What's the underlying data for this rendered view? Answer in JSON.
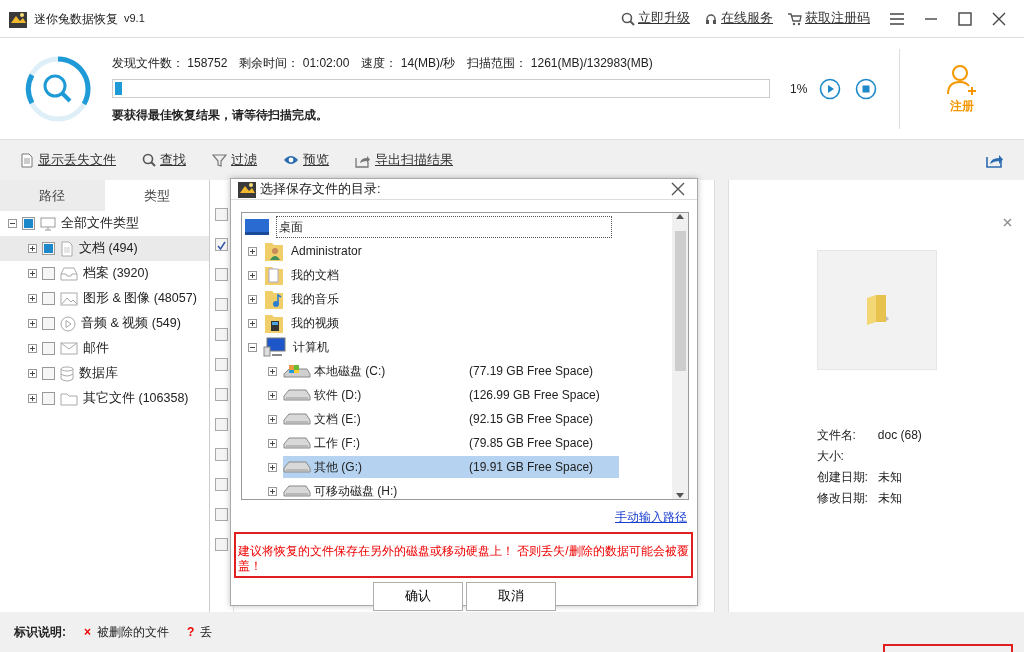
{
  "window": {
    "title": "迷你兔数据恢复",
    "version": "v9.1",
    "actions": [
      {
        "kind": "search",
        "label": "立即升级"
      },
      {
        "kind": "support",
        "label": "在线服务"
      },
      {
        "kind": "cart",
        "label": "获取注册码"
      }
    ]
  },
  "scan": {
    "stats": [
      {
        "label": "发现文件数：",
        "value": "158752"
      },
      {
        "label": "剩余时间：",
        "value": "01:02:00"
      },
      {
        "label": "速度：",
        "value": "14(MB)/秒"
      },
      {
        "label": "扫描范围：",
        "value": "1261(MB)/132983(MB)"
      }
    ],
    "level": 0.01,
    "percent": "1%",
    "message": "要获得最佳恢复结果，请等待扫描完成。",
    "register": "注册"
  },
  "toolbar": [
    {
      "kind": "doc",
      "label": "显示丢失文件"
    },
    {
      "kind": "search",
      "label": "查找"
    },
    {
      "kind": "filter",
      "label": "过滤"
    },
    {
      "kind": "eye",
      "label": "预览"
    },
    {
      "kind": "export",
      "label": "导出扫描结果"
    }
  ],
  "tabs": [
    {
      "label": "路径",
      "selected": false
    },
    {
      "label": "类型",
      "selected": true
    }
  ],
  "type_tree": {
    "label": "全部文件类型",
    "partial": true,
    "selected": false,
    "children": [
      {
        "kind": "document",
        "label": "文档 (494)",
        "partial": true,
        "selected": true
      },
      {
        "kind": "archive",
        "label": "档案 (3920)",
        "partial": false,
        "selected": false
      },
      {
        "kind": "image",
        "label": "图形 & 图像 (48057)",
        "partial": false,
        "selected": false
      },
      {
        "kind": "media",
        "label": "音频 & 视频 (549)",
        "partial": false,
        "selected": false
      },
      {
        "kind": "mail",
        "label": "邮件",
        "partial": false,
        "selected": false
      },
      {
        "kind": "database",
        "label": "数据库",
        "partial": false,
        "selected": false
      },
      {
        "kind": "folder",
        "label": "其它文件 (106358)",
        "partial": false,
        "selected": false
      }
    ]
  },
  "file_rows": [
    {
      "checked": false
    },
    {
      "checked": true
    },
    {
      "checked": false
    },
    {
      "checked": false
    },
    {
      "checked": false
    },
    {
      "checked": false
    },
    {
      "checked": false
    },
    {
      "checked": false
    },
    {
      "checked": false
    },
    {
      "checked": false
    },
    {
      "checked": false
    },
    {
      "checked": false
    }
  ],
  "preview": {
    "info": [
      {
        "label": "文件名:",
        "value": "doc (68)"
      },
      {
        "label": "大小:"
      },
      {
        "label": "创建日期:",
        "value": "未知"
      },
      {
        "label": "修改日期:",
        "value": "未知"
      }
    ]
  },
  "legend": {
    "title": "标识说明:",
    "items": [
      {
        "mark": "×",
        "label": "被删除的文件"
      },
      {
        "mark": "?",
        "label": "丢"
      }
    ]
  },
  "dialog": {
    "title": "选择保存文件的目录:",
    "tree": {
      "kind": "desktop",
      "label": "桌面",
      "focused": true,
      "children": [
        {
          "kind": "user",
          "label": "Administrator",
          "expanded": false
        },
        {
          "kind": "docs",
          "label": "我的文档",
          "expanded": false
        },
        {
          "kind": "music",
          "label": "我的音乐",
          "expanded": false
        },
        {
          "kind": "video",
          "label": "我的视频",
          "expanded": false
        },
        {
          "kind": "computer",
          "label": "计算机",
          "expanded": true,
          "children": [
            {
              "kind": "system",
              "label": "本地磁盘 (C:)",
              "free": "(77.19 GB Free Space)",
              "selected": false
            },
            {
              "kind": "drive",
              "label": "软件 (D:)",
              "free": "(126.99 GB Free Space)",
              "selected": false
            },
            {
              "kind": "drive",
              "label": "文档 (E:)",
              "free": "(92.15 GB Free Space)",
              "selected": false
            },
            {
              "kind": "drive",
              "label": "工作 (F:)",
              "free": "(79.85 GB Free Space)",
              "selected": false
            },
            {
              "kind": "drive",
              "label": "其他 (G:)",
              "free": "(19.91 GB Free Space)",
              "selected": true
            },
            {
              "kind": "drive",
              "label": "可移动磁盘 (H:)",
              "selected": false
            }
          ]
        }
      ]
    },
    "link": "手动输入路径",
    "warning": "建议将恢复的文件保存在另外的磁盘或移动硬盘上！ 否则丢失/删除的数据可能会被覆盖！",
    "buttons": [
      "确认",
      "取消"
    ]
  }
}
